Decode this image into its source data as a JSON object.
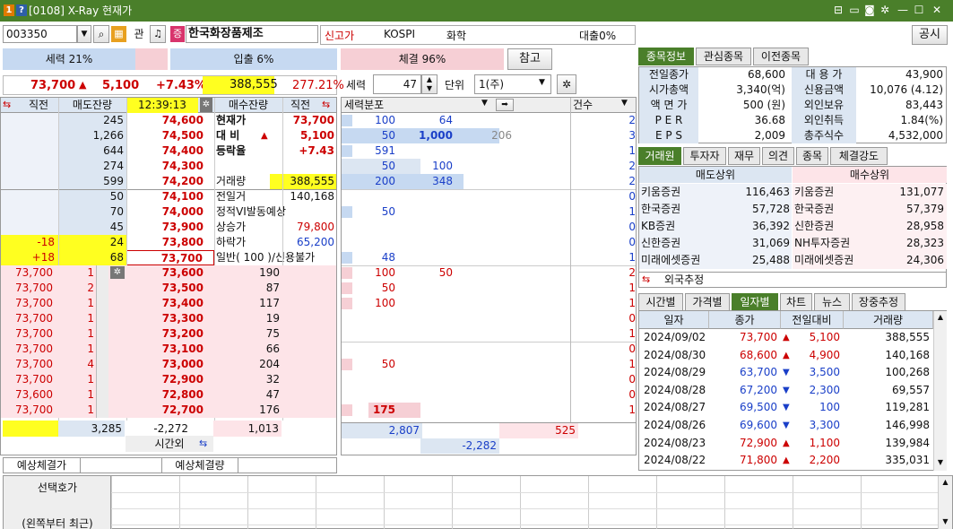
{
  "window": {
    "num1": "1",
    "num2": "?",
    "title": "[0108] X-Ray 현재가",
    "icons": [
      "pin-icon",
      "window-icon",
      "camera-icon",
      "gear-icon",
      "minimize-icon",
      "maximize-icon",
      "close-icon"
    ]
  },
  "top": {
    "code": "003350",
    "gwan": "관",
    "stock_badge": "증",
    "stock_name": "한국화장품제조",
    "new_high": "신고가",
    "market": "KOSPI",
    "sector": "화학",
    "loan": "대출0%",
    "public": "공시"
  },
  "strength": {
    "seryeok": "세력 21%",
    "ipchul": "입출 6%",
    "chegyeol": "체결 96%",
    "ref": "참고"
  },
  "summary": {
    "price": "73,700",
    "arrow": "▲",
    "change": "5,100",
    "rate": "+7.43%",
    "volume": "388,555",
    "turnover": "277.21%"
  },
  "controls": {
    "seryeok_label": "세력",
    "seryeok_val": "47",
    "unit_label": "단위",
    "unit_val": "1(주)"
  },
  "ob_header": {
    "prev": "직전",
    "sell_rem": "매도잔량",
    "time": "12:39:13",
    "buy_rem": "매수잔량",
    "prev2": "직전"
  },
  "asks": [
    {
      "qty": "245",
      "price": "74,600"
    },
    {
      "qty": "1,266",
      "price": "74,500"
    },
    {
      "qty": "644",
      "price": "74,400"
    },
    {
      "qty": "274",
      "price": "74,300"
    },
    {
      "qty": "599",
      "price": "74,200"
    },
    {
      "qty": "50",
      "price": "74,100"
    },
    {
      "qty": "70",
      "price": "74,000"
    },
    {
      "qty": "45",
      "price": "73,900"
    },
    {
      "qty": "24",
      "price": "73,800",
      "prev": "-18"
    },
    {
      "qty": "68",
      "price": "73,700",
      "prev": "+18"
    }
  ],
  "info": [
    {
      "label": "현재가",
      "value": "73,700"
    },
    {
      "label": "대  비",
      "arrow": "▲",
      "value": "5,100"
    },
    {
      "label": "등락율",
      "value": "+7.43"
    },
    {
      "label": "",
      "value": ""
    },
    {
      "label": "거래량",
      "value": "388,555"
    },
    {
      "label": "전일거",
      "value": "140,168"
    },
    {
      "label": "정적VI발동예상",
      "value": ""
    },
    {
      "label": "상승가",
      "value": "79,800"
    },
    {
      "label": "하락가",
      "value": "65,200"
    },
    {
      "label": "일반(  100  )/신용불가",
      "value": ""
    }
  ],
  "bids": [
    {
      "p": "73,700",
      "n": "1",
      "price": "73,600",
      "qty": "190"
    },
    {
      "p": "73,700",
      "n": "2",
      "price": "73,500",
      "qty": "87"
    },
    {
      "p": "73,700",
      "n": "1",
      "price": "73,400",
      "qty": "117"
    },
    {
      "p": "73,700",
      "n": "1",
      "price": "73,300",
      "qty": "19"
    },
    {
      "p": "73,700",
      "n": "1",
      "price": "73,200",
      "qty": "75"
    },
    {
      "p": "73,700",
      "n": "1",
      "price": "73,100",
      "qty": "66"
    },
    {
      "p": "73,700",
      "n": "4",
      "price": "73,000",
      "qty": "204"
    },
    {
      "p": "73,700",
      "n": "1",
      "price": "72,900",
      "qty": "32"
    },
    {
      "p": "73,600",
      "n": "1",
      "price": "72,800",
      "qty": "47"
    },
    {
      "p": "73,700",
      "n": "1",
      "price": "72,700",
      "qty": "176"
    }
  ],
  "totals": {
    "sell": "3,285",
    "diff": "-2,272",
    "buy": "1,013",
    "after_hours": "시간외",
    "exp_price": "예상체결가",
    "exp_qty": "예상체결량"
  },
  "dist": {
    "header": "세력분포",
    "count": "건수",
    "rows": [
      {
        "a": "100",
        "b": "64",
        "c": "",
        "n": "2"
      },
      {
        "a": "50",
        "b": "1,000",
        "c": "206",
        "n": "3"
      },
      {
        "a": "591",
        "b": "",
        "c": "",
        "n": "1"
      },
      {
        "a": "50",
        "b": "100",
        "c": "",
        "n": "2"
      },
      {
        "a": "200",
        "b": "348",
        "c": "",
        "n": "2"
      },
      {
        "a": "",
        "b": "",
        "c": "",
        "n": "0"
      },
      {
        "a": "50",
        "b": "",
        "c": "",
        "n": "1"
      },
      {
        "a": "",
        "b": "",
        "c": "",
        "n": "0"
      },
      {
        "a": "",
        "b": "",
        "c": "",
        "n": "0"
      },
      {
        "a": "48",
        "b": "",
        "c": "",
        "n": "1"
      },
      {
        "a": "100",
        "b": "50",
        "c": "",
        "n": "2"
      },
      {
        "a": "50",
        "b": "",
        "c": "",
        "n": "1"
      },
      {
        "a": "100",
        "b": "",
        "c": "",
        "n": "1"
      },
      {
        "a": "",
        "b": "",
        "c": "",
        "n": "0"
      },
      {
        "a": "",
        "b": "",
        "c": "",
        "n": "1"
      },
      {
        "a": "",
        "b": "",
        "c": "",
        "n": "0"
      },
      {
        "a": "50",
        "b": "",
        "c": "",
        "n": "1"
      },
      {
        "a": "",
        "b": "",
        "c": "",
        "n": "0"
      },
      {
        "a": "",
        "b": "",
        "c": "",
        "n": "0"
      },
      {
        "a": "175",
        "b": "",
        "c": "",
        "n": "1"
      }
    ],
    "total_sell": "2,807",
    "total_buy": "525",
    "diff": "-2,282"
  },
  "tabs1": [
    "종목정보",
    "관심종목",
    "이전종목"
  ],
  "stockinfo": [
    {
      "l1": "전일종가",
      "v1": "68,600",
      "l2": "대 용 가",
      "v2": "43,900"
    },
    {
      "l1": "시가총액",
      "v1": "3,340(억)",
      "l2": "신용금액",
      "v2": "10,076  (4.12)"
    },
    {
      "l1": "액 면 가",
      "v1": "500 (원)",
      "l2": "외인보유",
      "v2": "83,443"
    },
    {
      "l1": "P E R",
      "v1": "36.68",
      "l2": "외인취득",
      "v2": "1.84(%)"
    },
    {
      "l1": "E P S",
      "v1": "2,009",
      "l2": "총주식수",
      "v2": "4,532,000"
    }
  ],
  "tabs2": [
    "거래원",
    "투자자",
    "재무",
    "의견",
    "종목",
    "체결강도"
  ],
  "broker": {
    "sell_hdr": "매도상위",
    "buy_hdr": "매수상위",
    "rows": [
      {
        "s": "키움증권",
        "sv": "116,463",
        "b": "키움증권",
        "bv": "131,077"
      },
      {
        "s": "한국증권",
        "sv": "57,728",
        "b": "한국증권",
        "bv": "57,379"
      },
      {
        "s": "KB증권",
        "sv": "36,392",
        "b": "신한증권",
        "bv": "28,958"
      },
      {
        "s": "신한증권",
        "sv": "31,069",
        "b": "NH투자증권",
        "bv": "28,323"
      },
      {
        "s": "미래에셋증권",
        "sv": "25,488",
        "b": "미래에셋증권",
        "bv": "24,306"
      }
    ],
    "foreign": "외국추정"
  },
  "tabs3": [
    "시간별",
    "가격별",
    "일자별",
    "차트",
    "뉴스",
    "장중추정"
  ],
  "daily": {
    "headers": [
      "일자",
      "종가",
      "전일대비",
      "거래량"
    ],
    "rows": [
      {
        "d": "2024/09/02",
        "c": "73,700",
        "up": true,
        "chg": "5,100",
        "v": "388,555"
      },
      {
        "d": "2024/08/30",
        "c": "68,600",
        "up": true,
        "chg": "4,900",
        "v": "140,168"
      },
      {
        "d": "2024/08/29",
        "c": "63,700",
        "up": false,
        "chg": "3,500",
        "v": "100,268"
      },
      {
        "d": "2024/08/28",
        "c": "67,200",
        "up": false,
        "chg": "2,300",
        "v": "69,557"
      },
      {
        "d": "2024/08/27",
        "c": "69,500",
        "up": false,
        "chg": "100",
        "v": "119,281"
      },
      {
        "d": "2024/08/26",
        "c": "69,600",
        "up": false,
        "chg": "3,300",
        "v": "146,998"
      },
      {
        "d": "2024/08/23",
        "c": "72,900",
        "up": true,
        "chg": "1,100",
        "v": "139,984"
      },
      {
        "d": "2024/08/22",
        "c": "71,800",
        "up": true,
        "chg": "2,200",
        "v": "335,031"
      }
    ]
  },
  "bottom": {
    "select_label": "선택호가",
    "note": "(왼쪽부터 최근)"
  }
}
